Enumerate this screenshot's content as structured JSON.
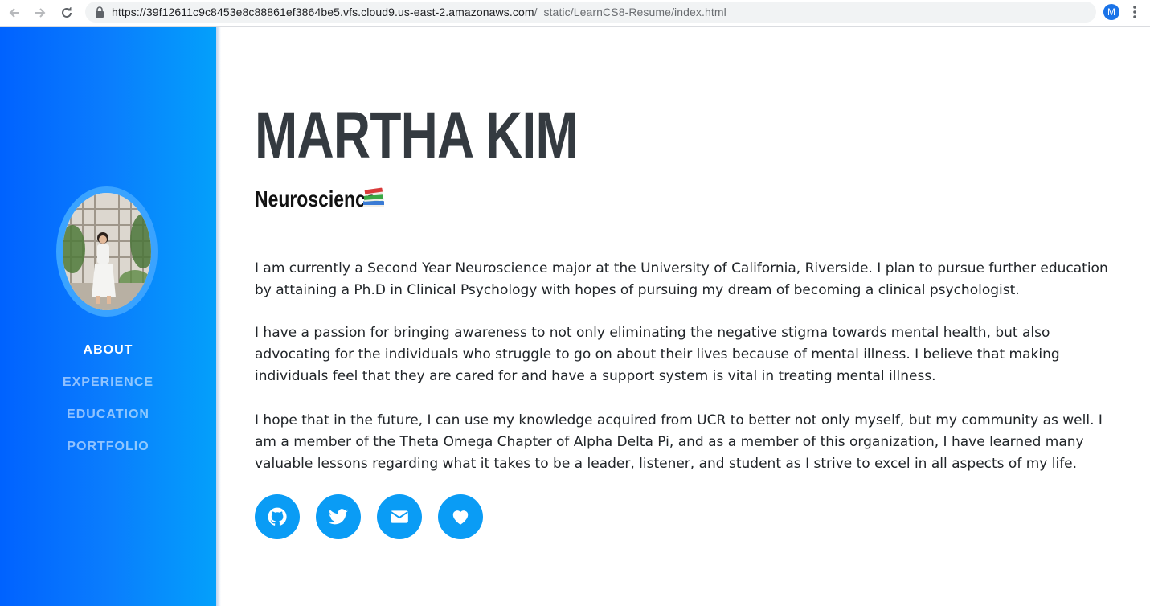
{
  "browser": {
    "url_host": "https://39f12611c9c8453e8c88861ef3864be5.vfs.cloud9.us-east-2.amazonaws.com",
    "url_path": "/_static/LearnCS8-Resume/index.html",
    "profile_initial": "M"
  },
  "sidebar": {
    "nav": [
      {
        "label": "ABOUT",
        "active": true
      },
      {
        "label": "EXPERIENCE",
        "active": false
      },
      {
        "label": "EDUCATION",
        "active": false
      },
      {
        "label": "PORTFOLIO",
        "active": false
      }
    ]
  },
  "main": {
    "name": "MARTHA KIM",
    "subtitle": "Neuroscience",
    "paragraphs": [
      "I am currently a Second Year Neuroscience major at the University of California, Riverside. I plan to pursue further education by attaining a Ph.D in Clinical Psychology with hopes of pursuing my dream of becoming a clinical psychologist.",
      "I have a passion for bringing awareness to not only eliminating the negative stigma towards mental health, but also advocating for the individuals who struggle to go on about their lives because of mental illness. I believe that making individuals feel that they are cared for and have a support system is vital in treating mental illness.",
      "I hope that in the future, I can use my knowledge acquired from UCR to better not only myself, but my community as well. I am a member of the Theta Omega Chapter of Alpha Delta Pi, and as a member of this organization, I have learned many valuable lessons regarding what it takes to be a leader, listener, and student as I strive to excel in all aspects of my life."
    ],
    "social_icons": [
      "github-icon",
      "twitter-icon",
      "envelope-icon",
      "heart-icon"
    ]
  },
  "colors": {
    "sidebar_start": "#0062ff",
    "sidebar_end": "#03a0fb",
    "accent": "#0a9cf5",
    "heading": "#343a40"
  }
}
